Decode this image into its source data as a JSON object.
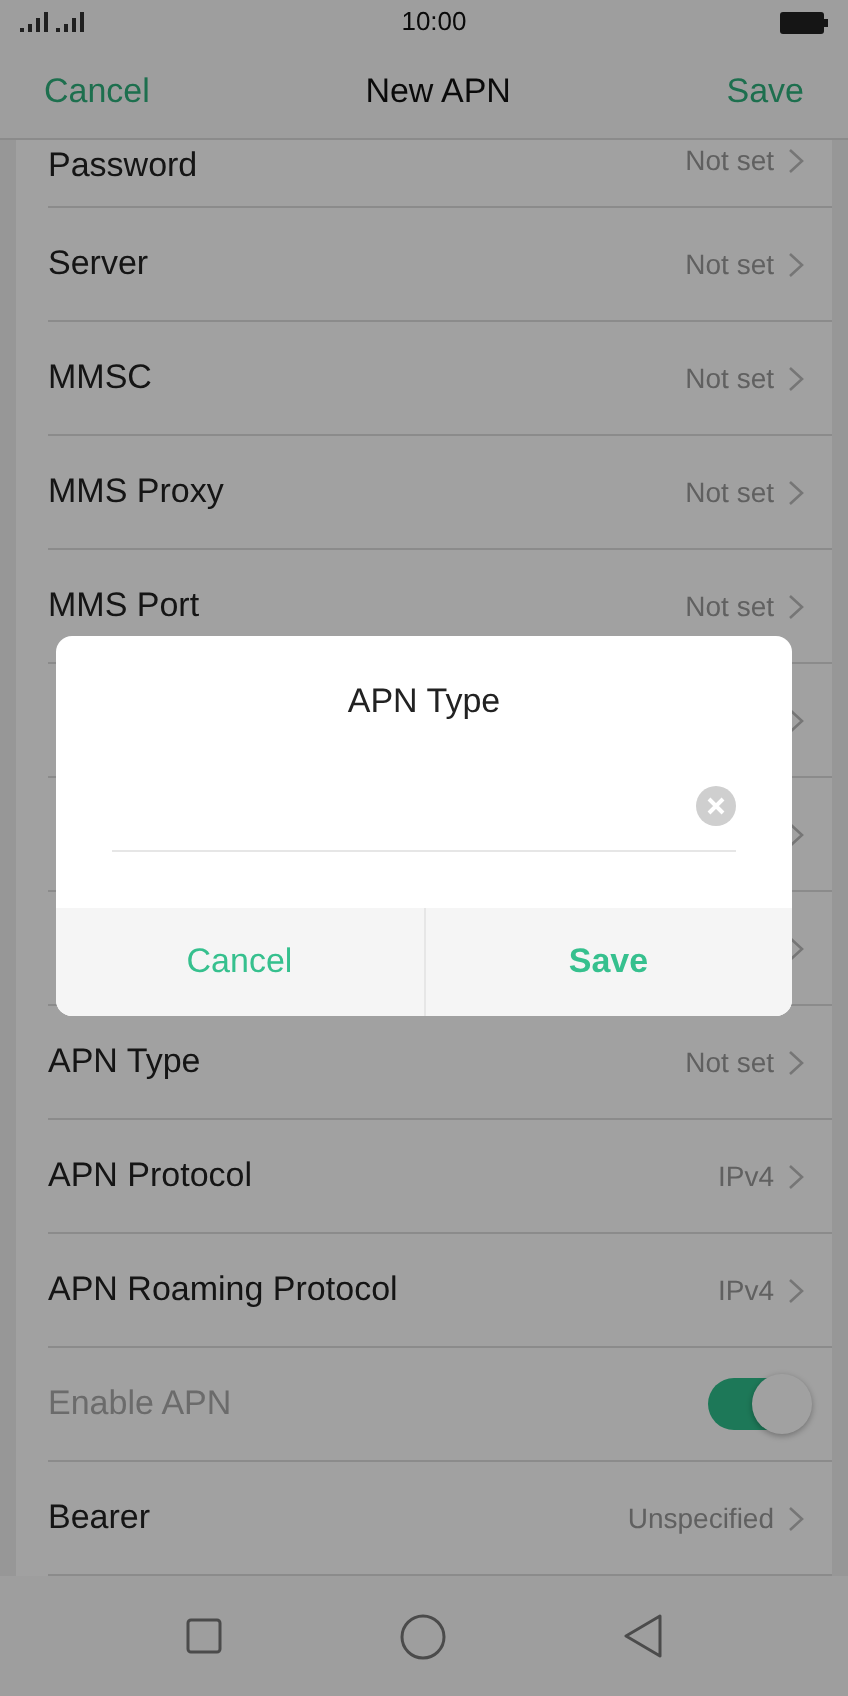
{
  "status_bar": {
    "time": "10:00"
  },
  "header": {
    "cancel": "Cancel",
    "title": "New APN",
    "save": "Save"
  },
  "settings": [
    {
      "kind": "value",
      "label": "Password",
      "value": "Not set"
    },
    {
      "kind": "value",
      "label": "Server",
      "value": "Not set"
    },
    {
      "kind": "value",
      "label": "MMSC",
      "value": "Not set"
    },
    {
      "kind": "value",
      "label": "MMS Proxy",
      "value": "Not set"
    },
    {
      "kind": "value",
      "label": "MMS Port",
      "value": "Not set"
    },
    {
      "kind": "covered"
    },
    {
      "kind": "covered"
    },
    {
      "kind": "covered"
    },
    {
      "kind": "value",
      "label": "APN Type",
      "value": "Not set"
    },
    {
      "kind": "value",
      "label": "APN Protocol",
      "value": "IPv4"
    },
    {
      "kind": "value",
      "label": "APN Roaming Protocol",
      "value": "IPv4"
    },
    {
      "kind": "toggle",
      "label": "Enable APN",
      "disabled": true,
      "on": true
    },
    {
      "kind": "value",
      "label": "Bearer",
      "value": "Unspecified"
    }
  ],
  "dialog": {
    "title": "APN Type",
    "buttons": [
      "Cancel",
      "Save"
    ]
  }
}
